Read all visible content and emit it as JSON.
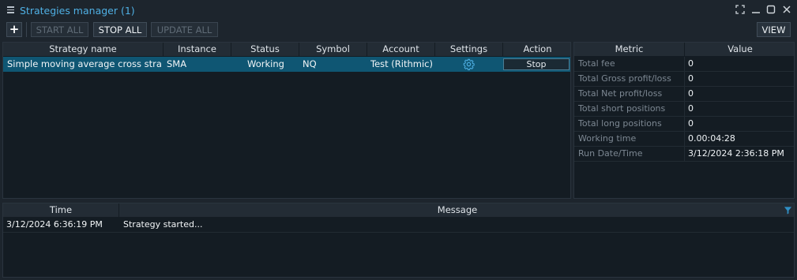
{
  "window": {
    "title": "Strategies manager (1)",
    "accent_color": "#4fb0e4",
    "controls": [
      "fullscreen-icon",
      "minimize-icon",
      "maximize-icon",
      "close-icon"
    ]
  },
  "toolbar": {
    "add_label": "+",
    "start_all_label": "START ALL",
    "stop_all_label": "STOP ALL",
    "update_all_label": "UPDATE ALL",
    "view_label": "VIEW"
  },
  "strategies": {
    "columns": [
      "Strategy name",
      "Instance name",
      "Status",
      "Symbol",
      "Account",
      "Settings",
      "Action"
    ],
    "rows": [
      {
        "strategy_name": "Simple moving average cross strategy",
        "instance_name": "SMA",
        "status": "Working",
        "symbol": "NQ",
        "account": "Test (Rithmic)",
        "settings_icon": "gear-icon",
        "action_label": "Stop"
      }
    ]
  },
  "metrics": {
    "columns": [
      "Metric",
      "Value"
    ],
    "rows": [
      {
        "metric": "Total fee",
        "value": "0"
      },
      {
        "metric": "Total Gross profit/loss",
        "value": "0"
      },
      {
        "metric": "Total Net profit/loss",
        "value": "0"
      },
      {
        "metric": "Total short positions",
        "value": "0"
      },
      {
        "metric": "Total long positions",
        "value": "0"
      },
      {
        "metric": "Working time",
        "value": "0.00:04:28"
      },
      {
        "metric": "Run Date/Time",
        "value": "3/12/2024 2:36:18 PM"
      }
    ]
  },
  "log": {
    "columns": [
      "Time",
      "Message"
    ],
    "filter_icon": "filter-icon",
    "rows": [
      {
        "time": "3/12/2024 6:36:19 PM",
        "message": "Strategy started..."
      }
    ]
  }
}
